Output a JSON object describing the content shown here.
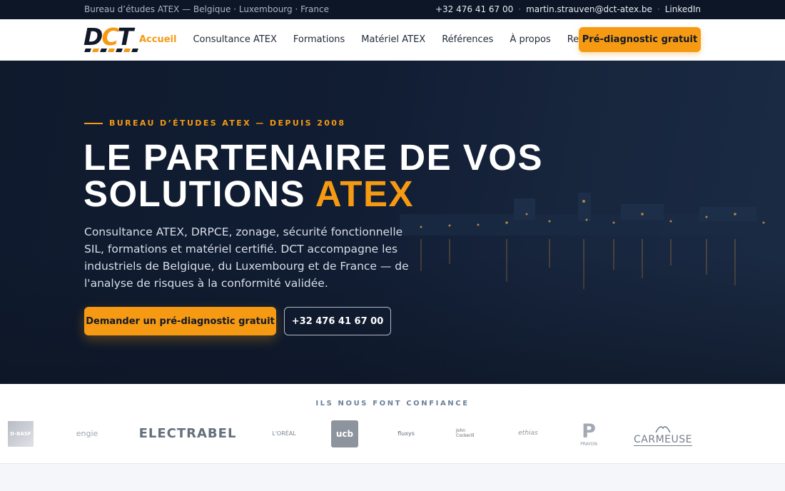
{
  "topbar": {
    "tagline": "Bureau d’études ATEX — Belgique · Luxembourg · France",
    "phone": "+32 476 41 67 00",
    "email": "martin.strauven@dct-atex.be",
    "linkedin": "LinkedIn",
    "separator": "·"
  },
  "nav": {
    "logo": "DCT",
    "items": [
      {
        "label": "Accueil",
        "active": true
      },
      {
        "label": "Consultance ATEX"
      },
      {
        "label": "Formations"
      },
      {
        "label": "Matériel ATEX"
      },
      {
        "label": "Références"
      },
      {
        "label": "À propos"
      },
      {
        "label": "Ressources"
      }
    ],
    "cta": "Pré-diagnostic gratuit"
  },
  "hero": {
    "eyebrow": "BUREAU D’ÉTUDES ATEX — DEPUIS 2008",
    "title_line1": "LE PARTENAIRE DE VOS",
    "title_line2": "SOLUTIONS ",
    "title_accent": "ATEX",
    "lead": "Consultance ATEX, DRPCE, zonage, sécurité fonctionnelle SIL, formations et matériel certifié. DCT accompagne les industriels de Belgique, du Luxembourg et de France — de l'analyse de risques à la conformité validée.",
    "primary_button": "Demander un pré-diagnostic gratuit",
    "secondary_button": "+32 476 41 67 00"
  },
  "trust": {
    "label": "ILS NOUS FONT CONFIANCE",
    "logos": [
      {
        "name": "BASF",
        "text": "D-BASF"
      },
      {
        "name": "ENGIE",
        "text": "engie"
      },
      {
        "name": "Electrabel",
        "text": "ELECTRABEL"
      },
      {
        "name": "L'Oréal",
        "text": "L'ORÉAL"
      },
      {
        "name": "UCB",
        "text": "ucb"
      },
      {
        "name": "Fluxys",
        "text": "fluxys"
      },
      {
        "name": "John Cockerill",
        "text": "John Cockerill"
      },
      {
        "name": "Ethias",
        "text": "ethias"
      },
      {
        "name": "Prayon",
        "text": "PRAYON",
        "mark": "P"
      },
      {
        "name": "Carmeuse",
        "text": "CARMEUSE"
      }
    ]
  },
  "colors": {
    "accent": "#f59a12",
    "topbar_bg": "#0d1626",
    "hero_bg": "#111d33"
  }
}
